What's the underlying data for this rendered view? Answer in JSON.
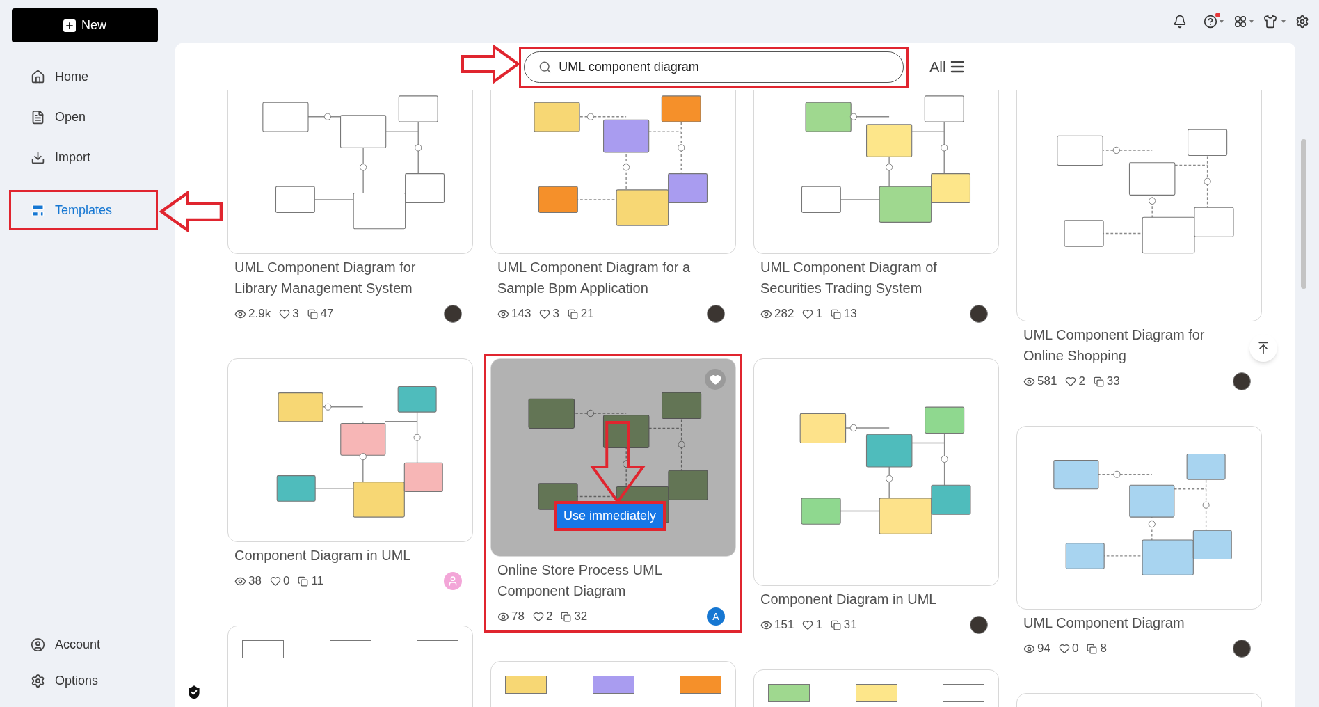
{
  "sidebar": {
    "new_button": "New",
    "items": [
      {
        "label": "Home",
        "selected": false,
        "annotated": false
      },
      {
        "label": "Open",
        "selected": false,
        "annotated": false
      },
      {
        "label": "Import",
        "selected": false,
        "annotated": false
      },
      {
        "label": "Templates",
        "selected": true,
        "annotated": true
      }
    ],
    "bottom_items": [
      {
        "label": "Account"
      },
      {
        "label": "Options"
      }
    ]
  },
  "topbar": {
    "help_notification": true
  },
  "search": {
    "value": "UML component diagram",
    "annotated": true
  },
  "filter": {
    "label": "All"
  },
  "columns": [
    [
      {
        "title": "UML Component Diagram for Library Management System",
        "views": "2.9k",
        "likes": "3",
        "copies": "47",
        "avatar": {
          "kind": "photo"
        },
        "hovered": false,
        "annotated": false
      },
      {
        "title": "Component Diagram in UML",
        "views": "38",
        "likes": "0",
        "copies": "11",
        "avatar": {
          "kind": "default"
        },
        "hovered": false,
        "annotated": false
      },
      {
        "hovered": false,
        "annotated": false
      }
    ],
    [
      {
        "title": "UML Component Diagram for a Sample Bpm Application",
        "views": "143",
        "likes": "3",
        "copies": "21",
        "avatar": {
          "kind": "photo"
        },
        "hovered": false,
        "annotated": false
      },
      {
        "title": "Online Store Process UML Component Diagram",
        "views": "78",
        "likes": "2",
        "copies": "32",
        "avatar": {
          "kind": "letter",
          "text": "A"
        },
        "hovered": true,
        "annotated": true,
        "use_button": {
          "label": "Use immediately",
          "annotated": true
        }
      },
      {
        "hovered": false,
        "annotated": false
      }
    ],
    [
      {
        "title": "UML Component Diagram of Securities Trading System",
        "views": "282",
        "likes": "1",
        "copies": "13",
        "avatar": {
          "kind": "photo"
        },
        "hovered": false,
        "annotated": false
      },
      {
        "title": "Component Diagram in UML",
        "views": "151",
        "likes": "1",
        "copies": "31",
        "avatar": {
          "kind": "photo"
        },
        "hovered": false,
        "annotated": false
      },
      {
        "hovered": false,
        "annotated": false
      }
    ],
    [
      {
        "title": "UML Component Diagram for Online Shopping",
        "views": "581",
        "likes": "2",
        "copies": "33",
        "avatar": {
          "kind": "photo"
        },
        "hovered": false,
        "annotated": false
      },
      {
        "title": "UML Component Diagram",
        "views": "94",
        "likes": "0",
        "copies": "8",
        "avatar": {
          "kind": "photo"
        },
        "hovered": false,
        "annotated": false
      },
      {
        "hovered": false,
        "annotated": false
      }
    ]
  ]
}
